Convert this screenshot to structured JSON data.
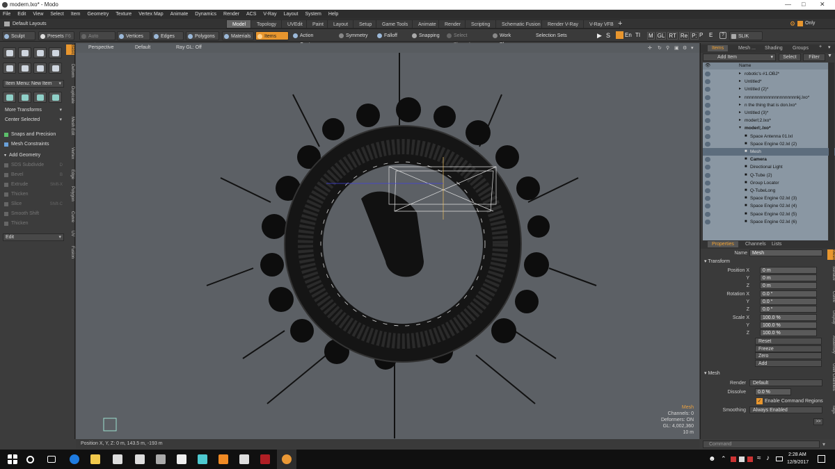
{
  "window": {
    "title": "modern.lxo* - Modo"
  },
  "menu": [
    "File",
    "Edit",
    "View",
    "Select",
    "Item",
    "Geometry",
    "Texture",
    "Vertex Map",
    "Animate",
    "Dynamics",
    "Render",
    "ACS",
    "V-Ray",
    "Layout",
    "System",
    "Help"
  ],
  "layout_dropdown": "Default Layouts",
  "tabs": [
    "Model",
    "Topology",
    "UVEdit",
    "Paint",
    "Layout",
    "Setup",
    "Game Tools",
    "Animate",
    "Render",
    "Scripting",
    "Schematic Fusion",
    "Render V-Ray",
    "V-Ray VFB"
  ],
  "active_tab": "Model",
  "only_label": "Only",
  "toolbar": {
    "sculpt": "Sculpt",
    "presets": "Presets",
    "presets_key": "F6",
    "auto_select": "Auto Select",
    "vertices": "Vertices",
    "edges": "Edges",
    "polygons": "Polygons",
    "materials": "Materials",
    "items": "Items",
    "action_center": "Action Center",
    "symmetry": "Symmetry",
    "falloff": "Falloff",
    "snapping": "Snapping",
    "select_through": "Select Through",
    "work_plane": "Work Plane",
    "selection_sets": "Selection Sets",
    "render_letters": [
      "M",
      "GL",
      "RT",
      "Re",
      "P:"
    ],
    "slik": "SLIK"
  },
  "left_panel": {
    "item_menu": "Item Menu: New Item",
    "more_transforms": "More Transforms",
    "center_selected": "Center Selected",
    "snaps": "Snaps and Precision",
    "mesh_constraints": "Mesh Constraints",
    "add_geometry": "Add Geometry",
    "tools": [
      {
        "label": "SDS Subdivide",
        "key": "D"
      },
      {
        "label": "Bevel",
        "key": "B"
      },
      {
        "label": "Extrude",
        "key": "Shift-X"
      },
      {
        "label": "Thicken",
        "key": ""
      },
      {
        "label": "Slice",
        "key": "Shift-C"
      },
      {
        "label": "Smooth Shift",
        "key": ""
      },
      {
        "label": "Thicken",
        "key": ""
      }
    ],
    "edit": "Edit",
    "vertical_tabs": [
      "Basic",
      "Deform",
      "Duplicate",
      "Mesh Edit",
      "Vertex",
      "Edge",
      "Polygon",
      "Curve",
      "UV",
      "Fusion"
    ]
  },
  "viewport": {
    "perspective": "Perspective",
    "default": "Default",
    "ray_gl": "Ray GL: Off",
    "info": [
      "Mesh",
      "Channels: 0",
      "Deformers: ON",
      "GL: 4,002,360",
      "10 m"
    ],
    "status": "Position X, Y, Z:  0 m, 143.5 m, -193 m"
  },
  "right_panel": {
    "tabs": [
      "Items",
      "Mesh ...",
      "Shading",
      "Groups"
    ],
    "add_item": "Add Item",
    "select": "Select",
    "filter": "Filter",
    "name_header": "Name",
    "tree": [
      {
        "label": "robotic's #1.OBJ*",
        "indent": 1,
        "bold": false,
        "sel": false
      },
      {
        "label": "Untitled*",
        "indent": 1,
        "bold": false,
        "sel": false
      },
      {
        "label": "Untitled (2)*",
        "indent": 1,
        "bold": false,
        "sel": false
      },
      {
        "label": "nnnnnnnnnnnnnnnnnnnnnkj.lxo*",
        "indent": 1,
        "bold": false,
        "sel": false
      },
      {
        "label": "n the thing that is don.lxo*",
        "indent": 1,
        "bold": false,
        "sel": false
      },
      {
        "label": "Untitled (3)*",
        "indent": 1,
        "bold": false,
        "sel": false
      },
      {
        "label": "moderl;2.lxo*",
        "indent": 1,
        "bold": false,
        "sel": false
      },
      {
        "label": "moderl;.lxo*",
        "indent": 1,
        "bold": true,
        "sel": false
      },
      {
        "label": "Space Antenna 01.lxl",
        "indent": 2,
        "bold": false,
        "sel": false
      },
      {
        "label": "Space Engine 02.lxl (2)",
        "indent": 2,
        "bold": false,
        "sel": false
      },
      {
        "label": "Mesh",
        "indent": 2,
        "bold": false,
        "sel": true
      },
      {
        "label": "Camera",
        "indent": 2,
        "bold": true,
        "sel": false
      },
      {
        "label": "Directional Light",
        "indent": 2,
        "bold": false,
        "sel": false
      },
      {
        "label": "Q-Tube (2)",
        "indent": 2,
        "bold": false,
        "sel": false
      },
      {
        "label": "Group Locator",
        "indent": 2,
        "bold": false,
        "sel": false
      },
      {
        "label": "Q-TubeLong",
        "indent": 2,
        "bold": false,
        "sel": false
      },
      {
        "label": "Space Engine 02.lxl (3)",
        "indent": 2,
        "bold": false,
        "sel": false
      },
      {
        "label": "Space Engine 02.lxl (4)",
        "indent": 2,
        "bold": false,
        "sel": false
      },
      {
        "label": "Space Engine 02.lxl (5)",
        "indent": 2,
        "bold": false,
        "sel": false
      },
      {
        "label": "Space Engine 02.lxl (6)",
        "indent": 2,
        "bold": false,
        "sel": false
      }
    ],
    "prop_tabs": [
      "Properties",
      "Channels",
      "Lists"
    ],
    "vertical_tabs": [
      "Mesh",
      "Surface",
      "Curve",
      "Display",
      "Assembly",
      "User Channels",
      "Tags"
    ],
    "name_label": "Name",
    "name_value": "Mesh",
    "transform_label": "Transform",
    "props": [
      {
        "label": "Position X",
        "value": "0 m"
      },
      {
        "label": "Y",
        "value": "0 m"
      },
      {
        "label": "Z",
        "value": "0 m"
      },
      {
        "label": "Rotation X",
        "value": "0.0 °"
      },
      {
        "label": "Y",
        "value": "0.0 °"
      },
      {
        "label": "Z",
        "value": "0.0 °"
      },
      {
        "label": "Scale X",
        "value": "100.0 %"
      },
      {
        "label": "Y",
        "value": "100.0 %"
      },
      {
        "label": "Z",
        "value": "100.0 %"
      }
    ],
    "actions": [
      "Reset",
      "Freeze",
      "Zero",
      "Add"
    ],
    "mesh_label": "Mesh",
    "render_label": "Render",
    "render_value": "Default",
    "dissolve_label": "Dissolve",
    "dissolve_value": "0.0 %",
    "enable_cmd": "Enable Command Regions",
    "smoothing_label": "Smoothing",
    "smoothing_value": "Always Enabled",
    "command_placeholder": "Command"
  },
  "taskbar": {
    "time": "2:28 AM",
    "date": "12/9/2017"
  },
  "colors": {
    "accent": "#e8962e",
    "viewport": "#5c6065",
    "panel": "#3a3a3a",
    "selected": "#6d7d8e"
  }
}
